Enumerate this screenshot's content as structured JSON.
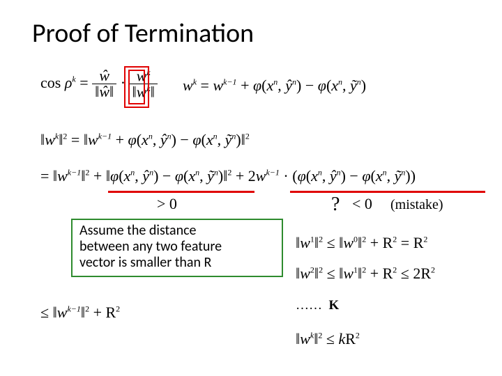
{
  "slide": {
    "title": "Proof of Termination",
    "eq_cos": "cos ρₖ = (ŵ / ‖ŵ‖) · (wᵏ / ‖wᵏ‖)",
    "eq_update": "wᵏ = wᵏ⁻¹ + φ(xⁿ, ŷⁿ) − φ(xⁿ, ỹⁿ)",
    "eq_norm_exp": "‖wᵏ‖² = ‖wᵏ⁻¹ + φ(xⁿ, ŷⁿ) − φ(xⁿ, ỹⁿ)‖²",
    "eq_expanded": "= ‖wᵏ⁻¹‖² + ‖φ(xⁿ, ŷⁿ) − φ(xⁿ, ỹⁿ)‖² + 2wᵏ⁻¹ · (φ(xⁿ, ŷⁿ) − φ(xⁿ, ỹⁿ))",
    "gt0": "> 0",
    "qmark": "?",
    "lt0": "< 0",
    "mistake": "(mistake)",
    "assume_l1": "Assume the distance",
    "assume_l2": "between any two feature",
    "assume_l3": "vector is smaller than R",
    "ineq1": "‖w¹‖² ≤ ‖w⁰‖² + R² = R²",
    "ineq2": "‖w²‖² ≤ ‖w¹‖² + R² ≤ 2R²",
    "dots": "…… K",
    "ineq3": "‖wᵏ‖² ≤ kR²",
    "eq_le": "≤ ‖wᵏ⁻¹‖² + R²"
  }
}
